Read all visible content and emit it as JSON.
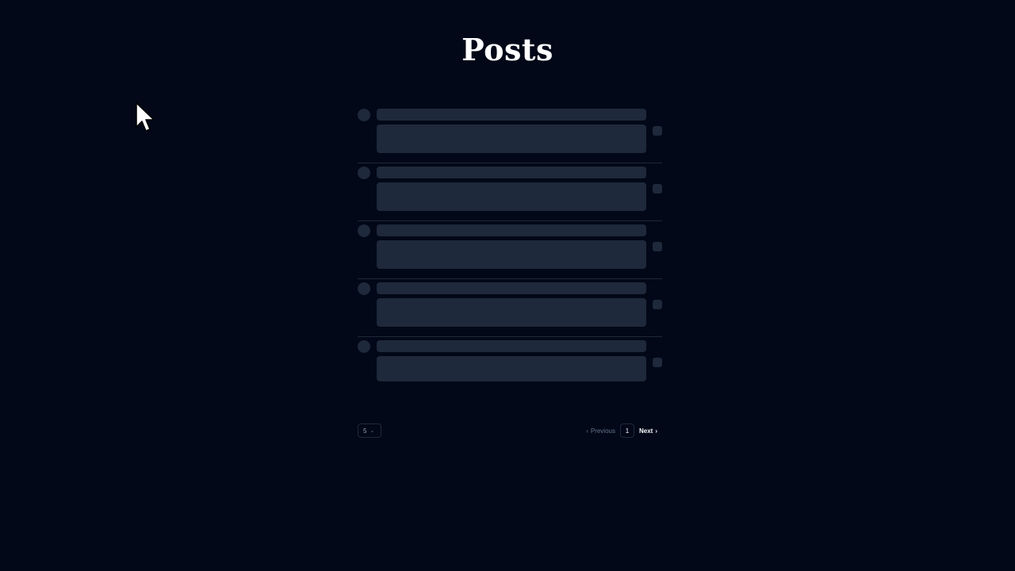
{
  "page": {
    "title": "Posts"
  },
  "posts": {
    "loading": true,
    "skeleton_rows": 5
  },
  "pagination": {
    "page_size": "5",
    "page_size_icon": "chevron-down-icon",
    "previous_label": "Previous",
    "previous_icon": "chevron-left-icon",
    "current_page": "1",
    "next_label": "Next",
    "next_icon": "chevron-right-icon"
  },
  "colors": {
    "background": "#020817",
    "skeleton": "#1e293b",
    "divider": "#1e293b",
    "text": "#f8fafc",
    "muted": "#64748b"
  }
}
